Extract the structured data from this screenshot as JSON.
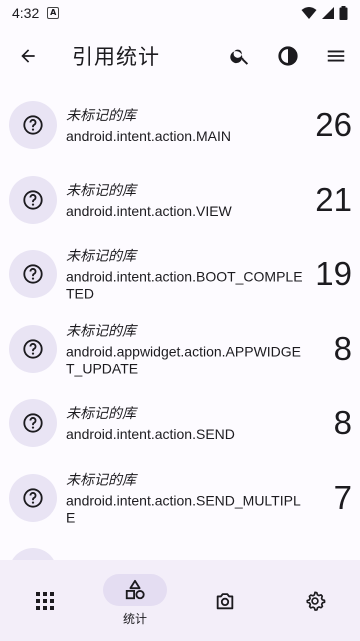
{
  "status": {
    "time": "4:32",
    "a_icon": "A"
  },
  "appbar": {
    "title": "引用统计"
  },
  "icons": {
    "back": "arrow-back-icon",
    "search": "search-icon",
    "chart": "pie-chart-icon",
    "menu": "menu-icon",
    "help": "help-circle-icon",
    "apps": "grid-icon",
    "stats": "shapes-icon",
    "camera": "camera-icon",
    "settings": "gear-icon"
  },
  "rows": [
    {
      "lib": "未标记的库",
      "name": "android.intent.action.MAIN",
      "count": "26"
    },
    {
      "lib": "未标记的库",
      "name": "android.intent.action.VIEW",
      "count": "21"
    },
    {
      "lib": "未标记的库",
      "name": "android.intent.action.BOOT_COMPLETED",
      "count": "19"
    },
    {
      "lib": "未标记的库",
      "name": "android.appwidget.action.APPWIDGET_UPDATE",
      "count": "8"
    },
    {
      "lib": "未标记的库",
      "name": "android.intent.action.SEND",
      "count": "8"
    },
    {
      "lib": "未标记的库",
      "name": "android.intent.action.SEND_MULTIPLE",
      "count": "7"
    }
  ],
  "nav": {
    "stats_label": "统计"
  }
}
